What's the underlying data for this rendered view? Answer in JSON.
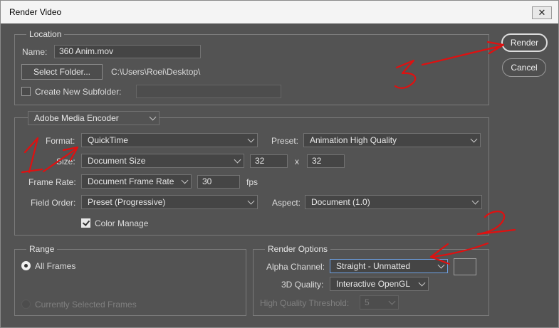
{
  "window": {
    "title": "Render Video",
    "close_glyph": "✕"
  },
  "location": {
    "group_label": "Location",
    "name_label": "Name:",
    "name_value": "360 Anim.mov",
    "select_folder_label": "Select Folder...",
    "folder_path": "C:\\Users\\Roei\\Desktop\\",
    "subfolder_label": "Create New Subfolder:",
    "subfolder_checked": false
  },
  "encoder": {
    "selected": "Adobe Media Encoder",
    "format_label": "Format:",
    "format_value": "QuickTime",
    "preset_label": "Preset:",
    "preset_value": "Animation High Quality",
    "size_label": "Size:",
    "size_value": "Document Size",
    "width": "32",
    "height": "32",
    "x_sep": "x",
    "frame_rate_label": "Frame Rate:",
    "frame_rate_value": "Document Frame Rate",
    "fps_value": "30",
    "fps_unit": "fps",
    "field_order_label": "Field Order:",
    "field_order_value": "Preset (Progressive)",
    "aspect_label": "Aspect:",
    "aspect_value": "Document (1.0)",
    "color_manage_label": "Color Manage",
    "color_manage_checked": true
  },
  "range": {
    "group_label": "Range",
    "all_frames_label": "All Frames",
    "selected_frames_label": "Currently Selected Frames",
    "selected": "All Frames"
  },
  "render_options": {
    "group_label": "Render Options",
    "alpha_label": "Alpha Channel:",
    "alpha_value": "Straight - Unmatted",
    "quality_label": "3D Quality:",
    "quality_value": "Interactive OpenGL",
    "threshold_label": "High Quality Threshold:",
    "threshold_value": "5",
    "matte_color": "#535353"
  },
  "buttons": {
    "render_label": "Render",
    "cancel_label": "Cancel"
  },
  "annotations": {
    "color": "#e01010",
    "marks": [
      "1",
      "2",
      "3"
    ]
  },
  "icons": [
    "close-icon",
    "chevron-down-icon",
    "checkmark-icon",
    "radio-icon"
  ]
}
